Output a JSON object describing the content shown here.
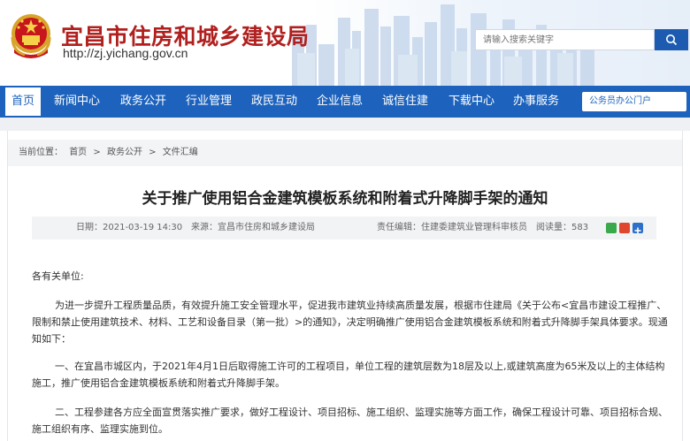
{
  "header": {
    "title": "宜昌市住房和城乡建设局",
    "url": "http://zj.yichang.gov.cn",
    "search_placeholder": "请输入搜索关键字",
    "emblem_icon": "national-emblem-icon"
  },
  "nav": {
    "items": [
      {
        "label": "首页"
      },
      {
        "label": "新闻中心"
      },
      {
        "label": "政务公开"
      },
      {
        "label": "行业管理"
      },
      {
        "label": "政民互动"
      },
      {
        "label": "企业信息"
      },
      {
        "label": "诚信住建"
      },
      {
        "label": "下载中心"
      },
      {
        "label": "办事服务"
      }
    ],
    "portal_label": "公务员办公门户"
  },
  "breadcrumb": {
    "prefix": "当前位置：",
    "items": [
      "首页",
      "政务公开",
      "文件汇编"
    ],
    "separator": ">"
  },
  "article": {
    "title": "关于推广使用铝合金建筑模板系统和附着式升降脚手架的通知",
    "date": "日期：2021-03-19 14:30",
    "source": "来源：宜昌市住房和城乡建设局",
    "editor": "责任编辑：住建委建筑业管理科审核员",
    "views": "阅读量：583",
    "greeting": "各有关单位:",
    "paragraphs": [
      "为进一步提升工程质量品质，有效提升施工安全管理水平，促进我市建筑业持续高质量发展，根据市住建局《关于公布<宜昌市建设工程推广、限制和禁止使用建筑技术、材料、工艺和设备目录（第一批）>的通知》，决定明确推广使用铝合金建筑模板系统和附着式升降脚手架具体要求。现通知如下：",
      "一、在宜昌市城区内，于2021年4月1日后取得施工许可的工程项目，单位工程的建筑层数为18层及以上,或建筑高度为65米及以上的主体结构施工，推广使用铝合金建筑模板系统和附着式升降脚手架。",
      "二、工程参建各方应全面宣贯落实推广要求，做好工程设计、项目招标、施工组织、监理实施等方面工作，确保工程设计可靠、项目招标合规、施工组织有序、监理实施到位。"
    ]
  },
  "colors": {
    "brand_red": "#b0201e",
    "nav_blue": "#1d63bd",
    "search_blue": "#1c5bb0"
  },
  "share_icons": [
    "wechat-share-icon",
    "weibo-share-icon",
    "plus-share-icon"
  ]
}
